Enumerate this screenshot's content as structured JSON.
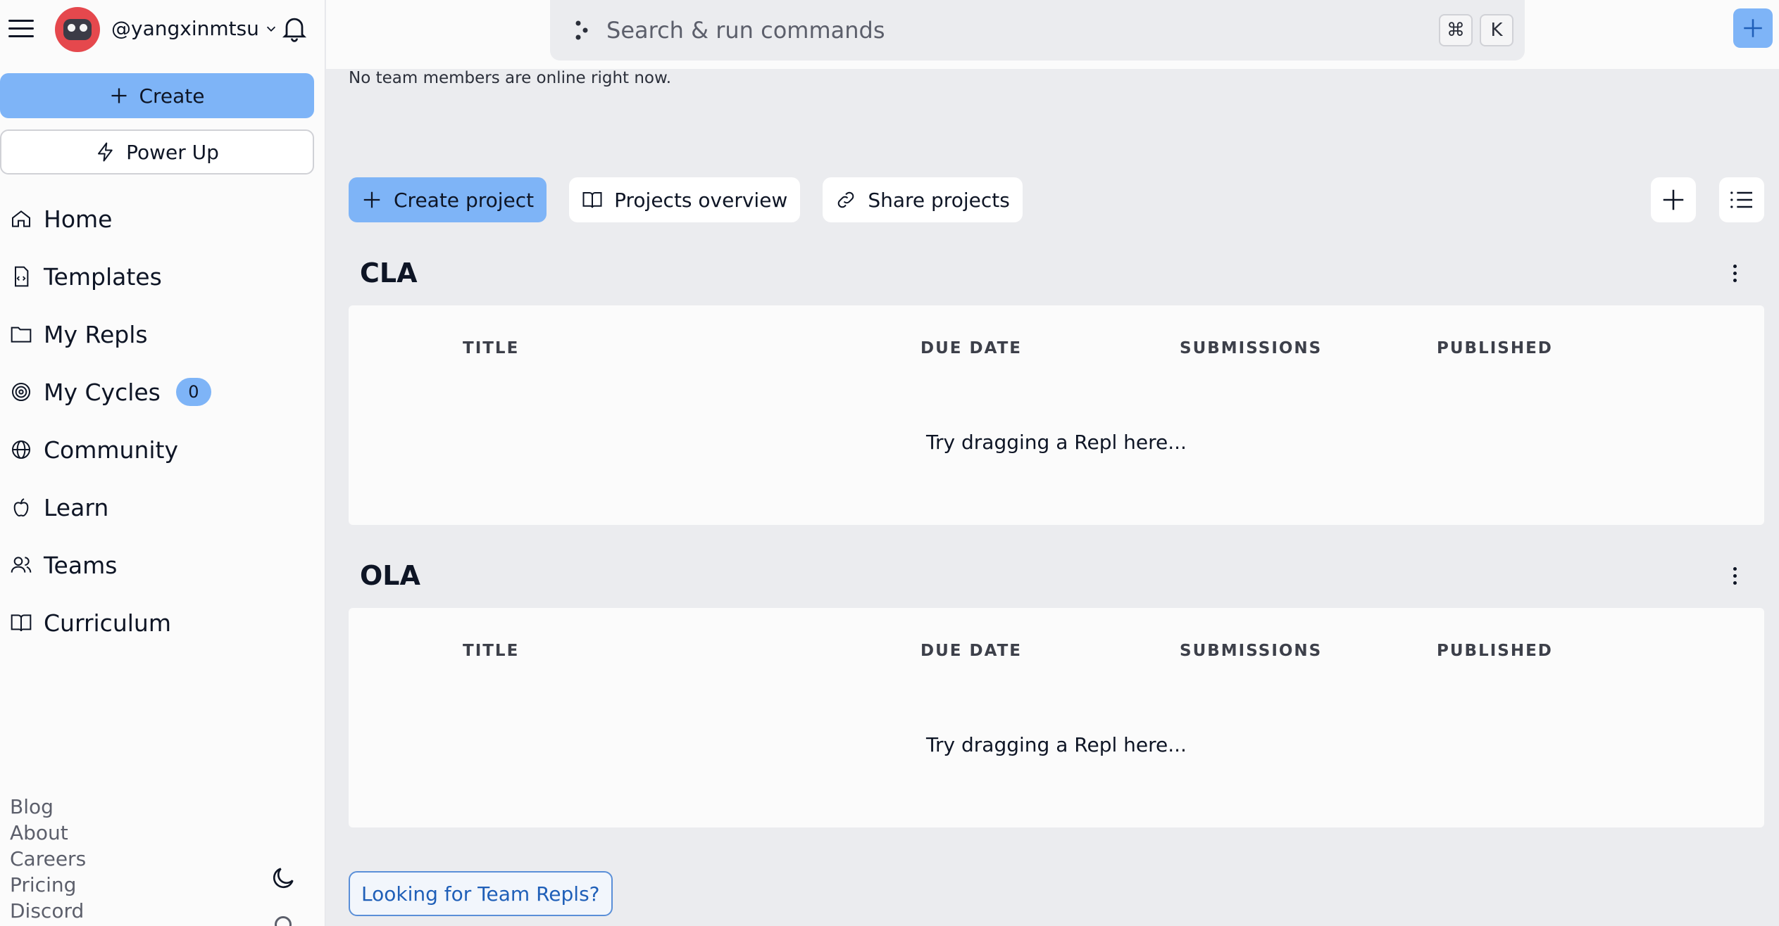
{
  "user": {
    "username": "@yangxinmtsu"
  },
  "sidebar": {
    "create_label": "Create",
    "powerup_label": "Power Up",
    "items": [
      {
        "label": "Home",
        "icon": "home-icon"
      },
      {
        "label": "Templates",
        "icon": "template-file-icon"
      },
      {
        "label": "My Repls",
        "icon": "folder-icon"
      },
      {
        "label": "My Cycles",
        "icon": "cycles-icon",
        "badge": "0"
      },
      {
        "label": "Community",
        "icon": "globe-icon"
      },
      {
        "label": "Learn",
        "icon": "apple-icon"
      },
      {
        "label": "Teams",
        "icon": "users-icon"
      },
      {
        "label": "Curriculum",
        "icon": "book-icon"
      }
    ],
    "footer_links": [
      "Blog",
      "About",
      "Careers",
      "Pricing",
      "Discord"
    ]
  },
  "search": {
    "placeholder": "Search & run commands",
    "shortcut_cmd": "⌘",
    "shortcut_key": "K"
  },
  "main": {
    "online_status": "No team members are online right now.",
    "actions": {
      "create_project": "Create project",
      "projects_overview": "Projects overview",
      "share_projects": "Share projects"
    },
    "sections": [
      {
        "title": "CLA",
        "columns": [
          "TITLE",
          "DUE DATE",
          "SUBMISSIONS",
          "PUBLISHED"
        ],
        "empty_text": "Try dragging a Repl here..."
      },
      {
        "title": "OLA",
        "columns": [
          "TITLE",
          "DUE DATE",
          "SUBMISSIONS",
          "PUBLISHED"
        ],
        "empty_text": "Try dragging a Repl here..."
      }
    ],
    "team_repls_label": "Looking for Team Repls?"
  },
  "colors": {
    "accent": "#7eb4f7",
    "background": "#ebecef",
    "surface": "#fbfbfb"
  }
}
